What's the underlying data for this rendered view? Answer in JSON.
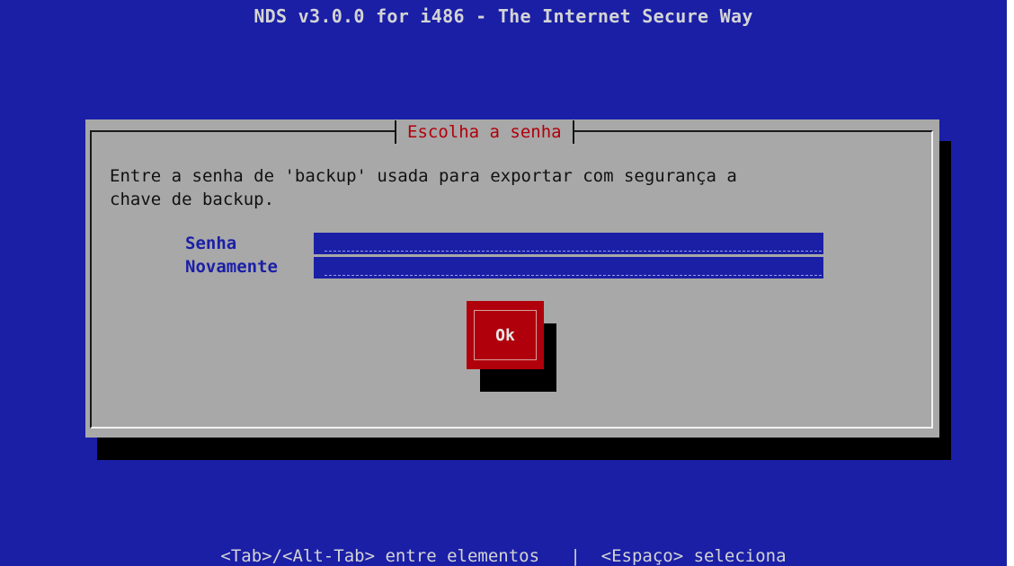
{
  "screen": {
    "title": "NDS v3.0.0 for i486 - The Internet Secure Way",
    "background_color": "#1a1fa6"
  },
  "dialog": {
    "title": "Escolha a senha",
    "title_color": "#b0000c",
    "message": "Entre a senha de 'backup' usada para exportar com segurança a\nchave de backup.",
    "fields": [
      {
        "label": "Senha",
        "value": ""
      },
      {
        "label": "Novamente",
        "value": ""
      }
    ],
    "ok_button": {
      "label": "Ok",
      "color": "#b0000c"
    }
  },
  "hint_bar": {
    "text": "<Tab>/<Alt-Tab> entre elementos   |  <Espaço> seleciona"
  }
}
